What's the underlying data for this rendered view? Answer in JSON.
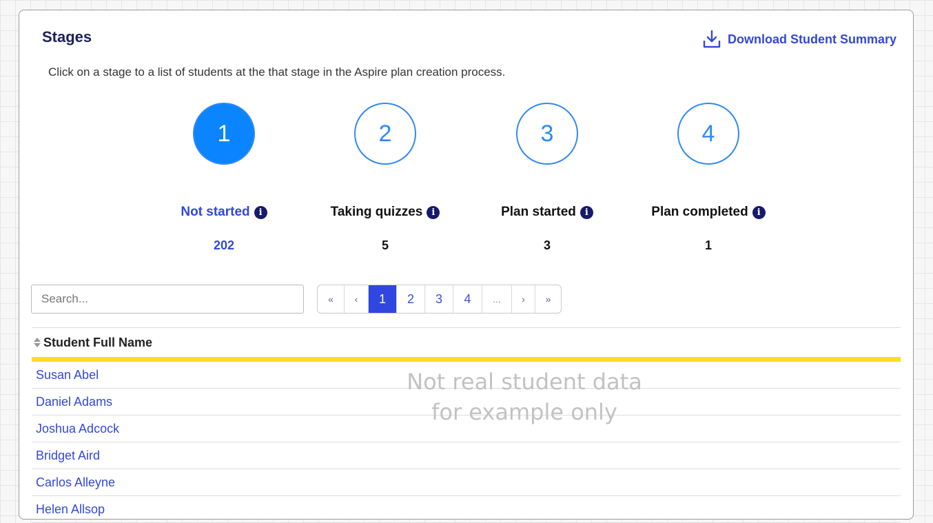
{
  "header": {
    "title": "Stages",
    "download_label": "Download Student Summary",
    "description": "Click on a stage to a list of students at the that stage in the Aspire plan creation process."
  },
  "stages": [
    {
      "number": "1",
      "label": "Not started",
      "count": "202",
      "active": true
    },
    {
      "number": "2",
      "label": "Taking quizzes",
      "count": "5",
      "active": false
    },
    {
      "number": "3",
      "label": "Plan started",
      "count": "3",
      "active": false
    },
    {
      "number": "4",
      "label": "Plan completed",
      "count": "1",
      "active": false
    }
  ],
  "search": {
    "placeholder": "Search...",
    "value": ""
  },
  "pagination": {
    "first": "«",
    "prev": "‹",
    "pages": [
      "1",
      "2",
      "3",
      "4"
    ],
    "ellipsis": "...",
    "next": "›",
    "last": "»",
    "current": "1"
  },
  "table": {
    "header": "Student Full Name",
    "rows": [
      "Susan Abel",
      "Daniel Adams",
      "Joshua Adcock",
      "Bridget Aird",
      "Carlos Alleyne",
      "Helen Allsop"
    ]
  },
  "watermark": {
    "line1": "Not real student data",
    "line2": "for example only"
  },
  "colors": {
    "accent": "#3248d8",
    "stage_active": "#0a84ff",
    "highlight": "#fcdc2a",
    "info_icon": "#171a6b"
  }
}
